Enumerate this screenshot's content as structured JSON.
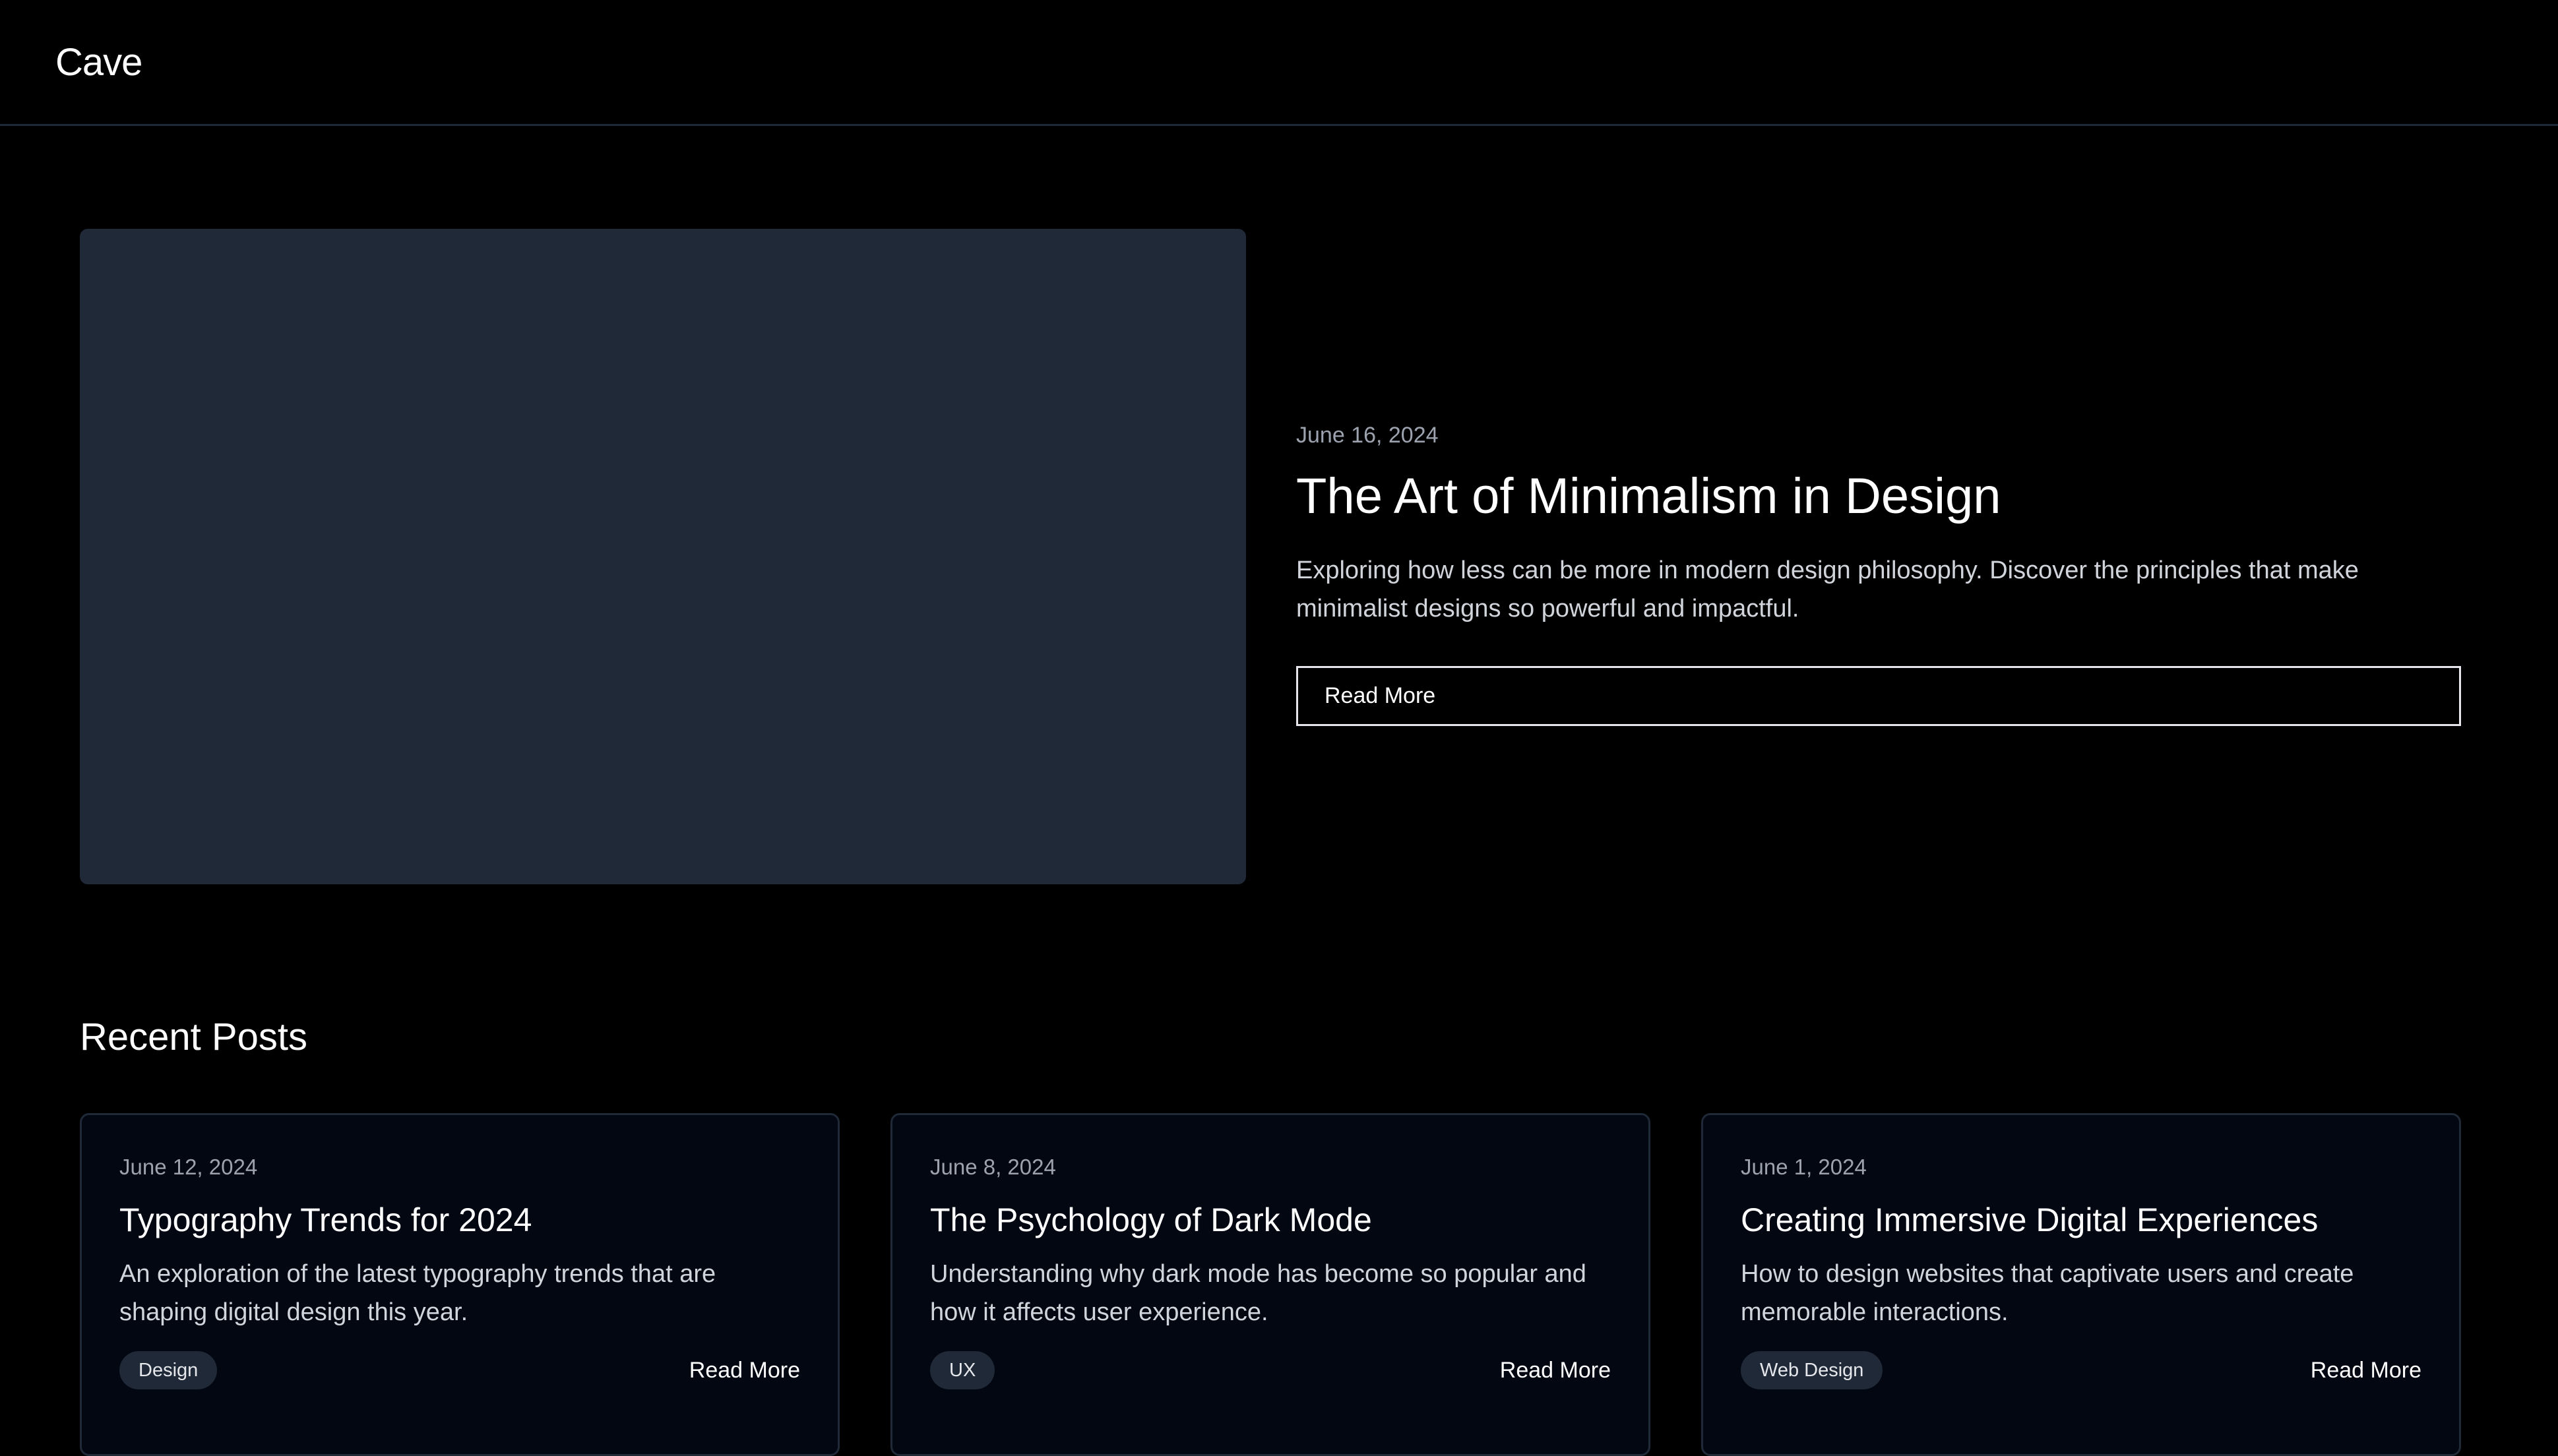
{
  "header": {
    "logo": "Cave"
  },
  "featured": {
    "date": "June 16, 2024",
    "title": "The Art of Minimalism in Design",
    "excerpt": "Exploring how less can be more in modern design philosophy. Discover the principles that make minimalist designs so powerful and impactful.",
    "button_label": "Read More"
  },
  "recent": {
    "heading": "Recent Posts",
    "posts": [
      {
        "date": "June 12, 2024",
        "title": "Typography Trends for 2024",
        "excerpt": "An exploration of the latest typography trends that are shaping digital design this year.",
        "tag": "Design",
        "link_label": "Read More"
      },
      {
        "date": "June 8, 2024",
        "title": "The Psychology of Dark Mode",
        "excerpt": "Understanding why dark mode has become so popular and how it affects user experience.",
        "tag": "UX",
        "link_label": "Read More"
      },
      {
        "date": "June 1, 2024",
        "title": "Creating Immersive Digital Experiences",
        "excerpt": "How to design websites that captivate users and create memorable interactions.",
        "tag": "Web Design",
        "link_label": "Read More"
      }
    ]
  },
  "colors": {
    "background": "#000000",
    "image_placeholder": "#1f2937",
    "text_primary": "#ffffff",
    "text_muted": "#9ca3af",
    "border": "#1f2937"
  }
}
